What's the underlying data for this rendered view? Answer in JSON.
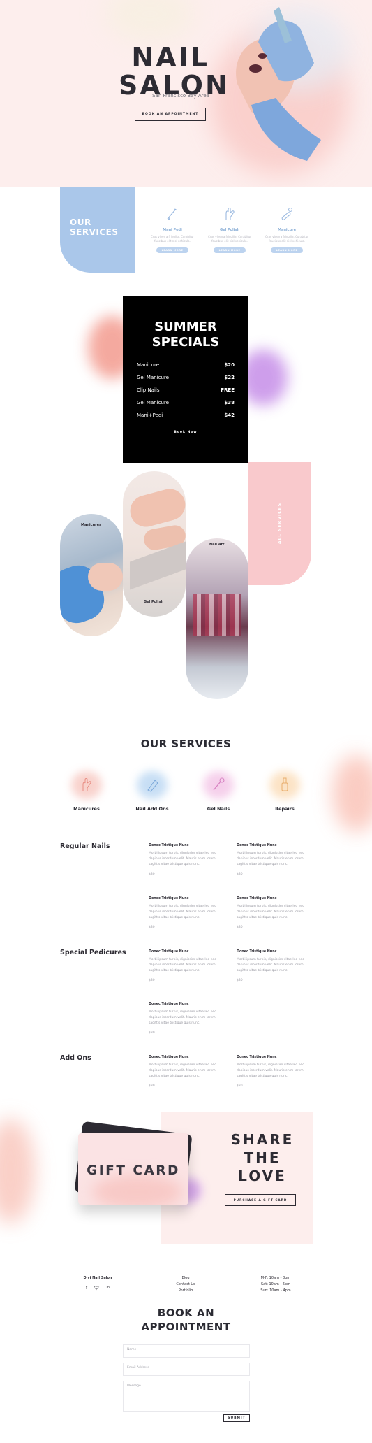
{
  "hero": {
    "title_line1": "NAIL",
    "title_line2": "SALON",
    "subtitle": "San Francisco Bay Area",
    "button": "BOOK AN APPOINTMENT"
  },
  "services_strip": {
    "box_title_line1": "OUR",
    "box_title_line2": "SERVICES",
    "items": [
      {
        "name": "Mani Pedi",
        "desc": "Cras viverra fringilla. Curabitur faucibus elit nisl vehicula.",
        "button": "LEARN MORE",
        "icon": "brush-icon"
      },
      {
        "name": "Gel Polish",
        "desc": "Cras viverra fringilla. Curabitur faucibus elit nisl vehicula.",
        "button": "LEARN MORE",
        "icon": "hand-icon"
      },
      {
        "name": "Manicure",
        "desc": "Cras viverra fringilla. Curabitur faucibus elit nisl vehicula.",
        "button": "LEARN MORE",
        "icon": "nail-file-icon"
      }
    ]
  },
  "specials": {
    "title_line1": "SUMMER",
    "title_line2": "SPECIALS",
    "rows": [
      {
        "name": "Manicure",
        "price": "$20"
      },
      {
        "name": "Gel Manicure",
        "price": "$22"
      },
      {
        "name": "Clip Nails",
        "price": "FREE"
      },
      {
        "name": "Gel Manicure",
        "price": "$38"
      },
      {
        "name": "Mani+Pedi",
        "price": "$42"
      }
    ],
    "button": "Book Now"
  },
  "gallery": {
    "labels": [
      "Manicures",
      "Gel Polish",
      "Nail Art"
    ],
    "all_services": "ALL SERVICES"
  },
  "our_services": {
    "title": "OUR SERVICES",
    "items": [
      {
        "name": "Manicures",
        "icon": "hand-icon",
        "color": "#f7c7c0"
      },
      {
        "name": "Nail Add Ons",
        "icon": "nail-icon",
        "color": "#b9d6f2"
      },
      {
        "name": "Gel Nails",
        "icon": "brush-icon",
        "color": "#f3c4e6"
      },
      {
        "name": "Repairs",
        "icon": "bottle-icon",
        "color": "#fbdcb7"
      }
    ]
  },
  "menu": {
    "categories": [
      {
        "name": "Regular Nails",
        "items": [
          {
            "title": "Donec Tristique Nunc",
            "desc": "Morbi ipsum turpis, dignissim vitae leo nec dapibus interdum velit. Mauris enim lorem sagittis vitae tristique quis nunc.",
            "price": "$30"
          },
          {
            "title": "Donec Tristique Nunc",
            "desc": "Morbi ipsum turpis, dignissim vitae leo nec dapibus interdum velit. Mauris enim lorem sagittis vitae tristique quis nunc.",
            "price": "$30"
          },
          {
            "title": "Donec Tristique Nunc",
            "desc": "Morbi ipsum turpis, dignissim vitae leo nec dapibus interdum velit. Mauris enim lorem sagittis vitae tristique quis nunc.",
            "price": "$30"
          },
          {
            "title": "Donec Tristique Nunc",
            "desc": "Morbi ipsum turpis, dignissim vitae leo nec dapibus interdum velit. Mauris enim lorem sagittis vitae tristique quis nunc.",
            "price": "$30"
          }
        ]
      },
      {
        "name": "Special Pedicures",
        "items": [
          {
            "title": "Donec Tristique Nunc",
            "desc": "Morbi ipsum turpis, dignissim vitae leo nec dapibus interdum velit. Mauris enim lorem sagittis vitae tristique quis nunc.",
            "price": "$30"
          },
          {
            "title": "Donec Tristique Nunc",
            "desc": "Morbi ipsum turpis, dignissim vitae leo nec dapibus interdum velit. Mauris enim lorem sagittis vitae tristique quis nunc.",
            "price": "$30"
          },
          {
            "title": "Donec Tristique Nunc",
            "desc": "Morbi ipsum turpis, dignissim vitae leo nec dapibus interdum velit. Mauris enim lorem sagittis vitae tristique quis nunc.",
            "price": "$30"
          }
        ]
      },
      {
        "name": "Add Ons",
        "items": [
          {
            "title": "Donec Tristique Nunc",
            "desc": "Morbi ipsum turpis, dignissim vitae leo nec dapibus interdum velit. Mauris enim lorem sagittis vitae tristique quis nunc.",
            "price": "$30"
          },
          {
            "title": "Donec Tristique Nunc",
            "desc": "Morbi ipsum turpis, dignissim vitae leo nec dapibus interdum velit. Mauris enim lorem sagittis vitae tristique quis nunc.",
            "price": "$30"
          }
        ]
      }
    ]
  },
  "gift": {
    "card_text": "GIFT CARD",
    "share_line1": "SHARE",
    "share_line2": "THE",
    "share_line3": "LOVE",
    "button": "PURCHASE A GIFT CARD"
  },
  "footer": {
    "brand": "Divi Nail Salon",
    "links": [
      "Blog",
      "Contact Us",
      "Portfolio"
    ],
    "hours": [
      "M-F: 10am - 8pm",
      "Sat: 10am - 6pm",
      "Sun: 10am - 4pm"
    ]
  },
  "book": {
    "title_line1": "BOOK AN",
    "title_line2": "APPOINTMENT",
    "name_placeholder": "Name",
    "email_placeholder": "Email Address",
    "message_placeholder": "Message",
    "submit": "SUBMIT"
  },
  "colors": {
    "blush": "#fdeeed",
    "accent_blue": "#aac7ea",
    "accent_pink": "#f9c9cc",
    "dark": "#2d2b33"
  }
}
